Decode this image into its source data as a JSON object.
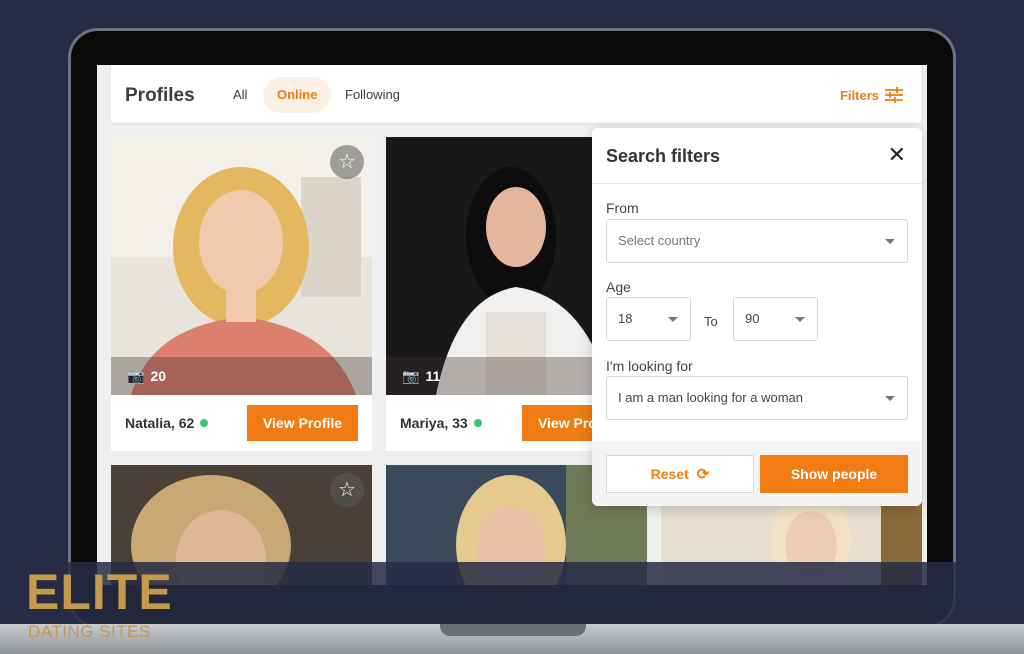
{
  "header": {
    "title": "Profiles",
    "tabs": [
      {
        "label": "All",
        "active": false
      },
      {
        "label": "Online",
        "active": true
      },
      {
        "label": "Following",
        "active": false
      }
    ],
    "filters_label": "Filters",
    "filters_icon": "sliders-icon"
  },
  "profiles": [
    {
      "name": "Natalia, 62",
      "online": true,
      "photo_count": "20",
      "button": "View Profile"
    },
    {
      "name": "Mariya, 33",
      "online": true,
      "photo_count": "11",
      "button": "View Profile"
    }
  ],
  "search_filters": {
    "title": "Search filters",
    "from_label": "From",
    "country_placeholder": "Select country",
    "age_label": "Age",
    "age_from": "18",
    "to_label": "To",
    "age_to": "90",
    "looking_label": "I'm looking for",
    "looking_value": "I am a man looking for a woman",
    "reset_label": "Reset",
    "show_label": "Show people"
  },
  "watermark": {
    "brand": "ELITE",
    "tagline": "DATING SITES"
  },
  "colors": {
    "accent": "#f07c13",
    "online": "#37c777",
    "brand_gold": "#c49a4d"
  }
}
